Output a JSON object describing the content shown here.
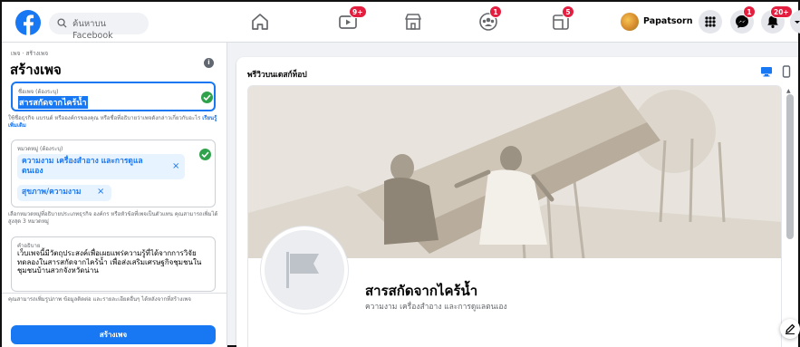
{
  "topbar": {
    "search_placeholder": "ค้นหาบน Facebook",
    "profile_name": "Papatsorn",
    "badges": {
      "watch": "9+",
      "groups": "1",
      "gaming": "5",
      "messenger": "1",
      "notifications": "20+"
    }
  },
  "left": {
    "breadcrumb": "เพจ · สร้างเพจ",
    "title": "สร้างเพจ",
    "page_name_label": "ชื่อเพจ (ต้องระบุ)",
    "page_name_value": "สารสกัดจากไคร้น้ำ",
    "page_name_help": "ใช้ชื่อธุรกิจ แบรนด์ หรือองค์กรของคุณ หรือชื่อที่อธิบายว่าเพจดังกล่าวเกี่ยวกับอะไร",
    "learn_more": "เรียนรู้เพิ่มเติม",
    "category_label": "หมวดหมู่ (ต้องระบุ)",
    "categories": [
      "ความงาม เครื่องสำอาง และการดูแลตนเอง",
      "สุขภาพ/ความงาม"
    ],
    "category_help": "เลือกหมวดหมู่ที่อธิบายประเภทธุรกิจ องค์กร หรือหัวข้อที่เพจเป็นตัวแทน คุณสามารถเพิ่มได้สูงสุด 3 หมวดหมู่",
    "description_label": "คำอธิบาย",
    "description_value": "เว็บเพจนี้มีวัตถุประสงค์เพื่อเผยแพร่ความรู้ที่ได้จากการวิจัยทดลองในสารสกัดจากไคร้น้ำ เพื่อส่งเสริมเศรษฐกิจชุมชนในชุมชนบ้านสวกจังหวัดน่าน",
    "footer_note": "คุณสามารถเพิ่มรูปภาพ ข้อมูลติดต่อ และรายละเอียดอื่นๆ ได้หลังจากที่สร้างเพจ",
    "create_button": "สร้างเพจ"
  },
  "preview": {
    "title": "พรีวิวบนเดสก์ท็อป",
    "page_name": "สารสกัดจากไคร้น้ำ",
    "page_category": "ความงาม เครื่องสำอาง และการดูแลตนเอง"
  },
  "colors": {
    "brand": "#1877f2",
    "success": "#31a24c",
    "badge": "#e41e3f"
  }
}
